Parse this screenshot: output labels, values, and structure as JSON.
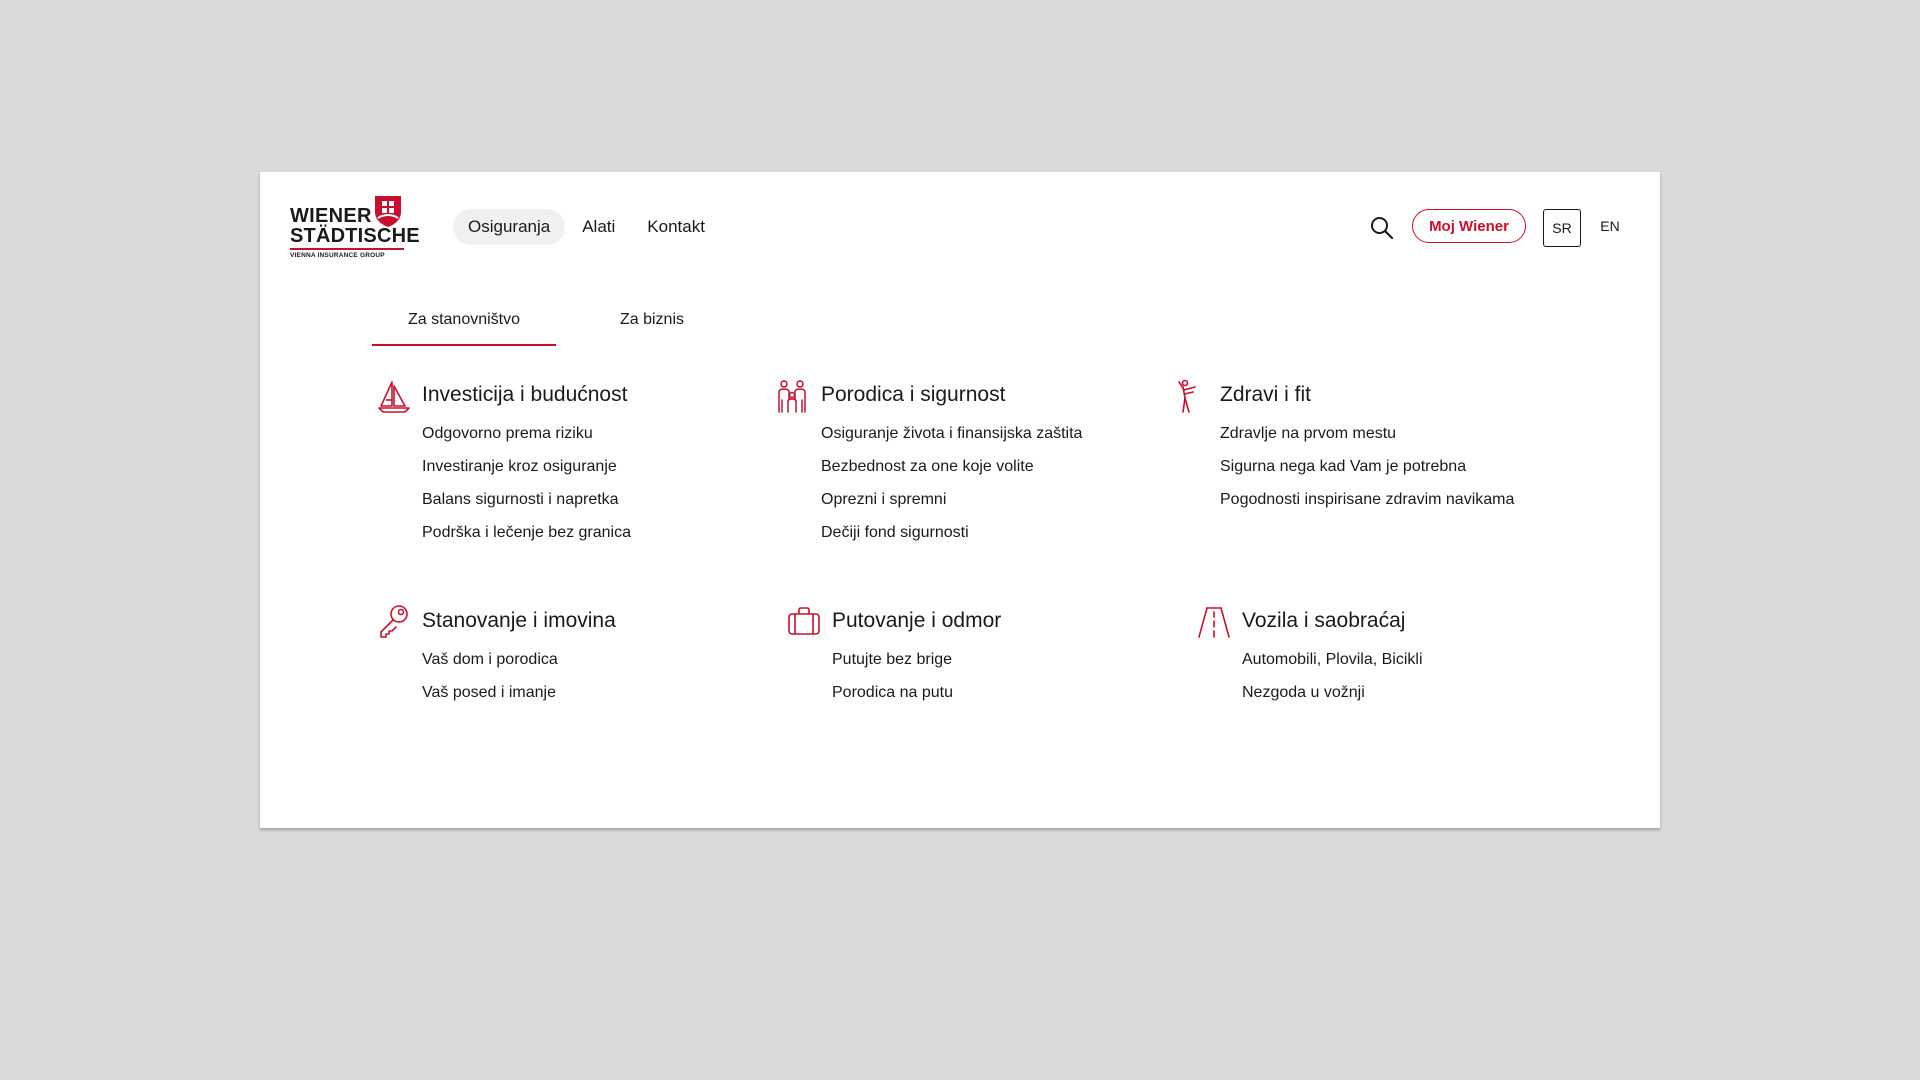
{
  "brand": {
    "name_line1": "WIENER",
    "name_line2": "STÄDTISCHE",
    "tagline": "VIENNA INSURANCE GROUP",
    "color": "#c8102e"
  },
  "nav": {
    "items": [
      {
        "label": "Osiguranja",
        "active": true
      },
      {
        "label": "Alati",
        "active": false
      },
      {
        "label": "Kontakt",
        "active": false
      }
    ]
  },
  "header": {
    "search_icon": "search-icon",
    "account_button": "Moj Wiener",
    "languages": [
      "SR",
      "EN"
    ],
    "active_language": "SR"
  },
  "tabs": [
    {
      "label": "Za stanovništvo",
      "active": true
    },
    {
      "label": "Za biznis",
      "active": false
    }
  ],
  "categories": [
    {
      "icon": "sailboat-icon",
      "title": "Investicija i budućnost",
      "links": [
        "Odgovorno prema riziku",
        "Investiranje kroz osiguranje",
        "Balans sigurnosti i napretka",
        "Podrška i lečenje bez granica"
      ]
    },
    {
      "icon": "family-icon",
      "title": "Porodica i sigurnost",
      "links": [
        "Osiguranje života i finansijska zaštita",
        "Bezbednost za one koje volite",
        "Oprezni i spremni",
        "Dečiji fond sigurnosti"
      ]
    },
    {
      "icon": "fitness-icon",
      "title": "Zdravi i fit",
      "links": [
        "Zdravlje na prvom mestu",
        "Sigurna nega kad Vam je potrebna",
        "Pogodnosti inspirisane zdravim navikama"
      ]
    },
    {
      "icon": "key-icon",
      "title": "Stanovanje i imovina",
      "links": [
        "Vaš dom i porodica",
        "Vaš posed i imanje"
      ]
    },
    {
      "icon": "suitcase-icon",
      "title": "Putovanje i odmor",
      "links": [
        "Putujte bez brige",
        "Porodica na putu"
      ]
    },
    {
      "icon": "road-icon",
      "title": "Vozila i saobraćaj",
      "links": [
        "Automobili, Plovila, Bicikli",
        "Nezgoda u vožnji"
      ]
    }
  ]
}
